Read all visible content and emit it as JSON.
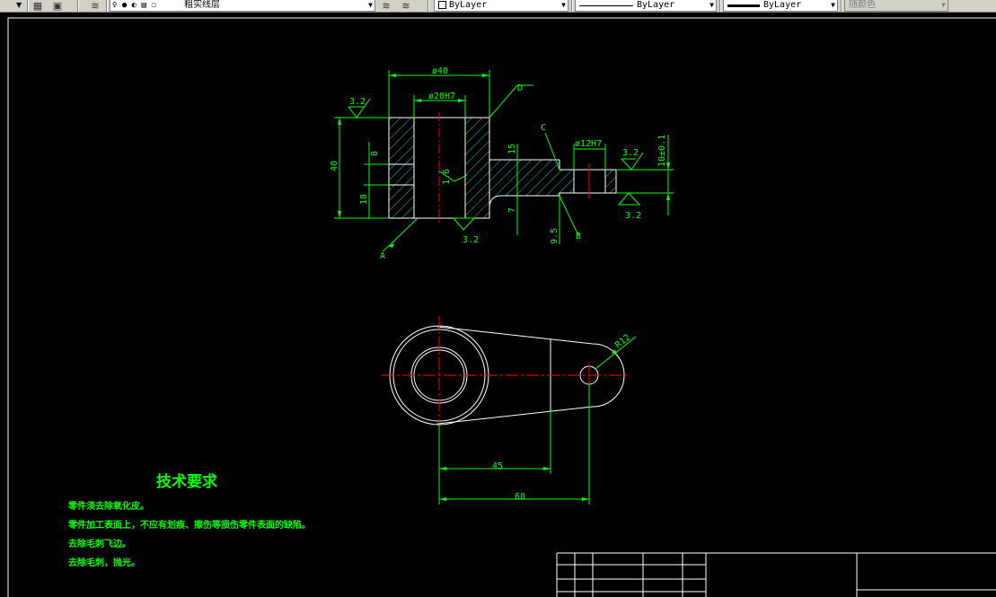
{
  "toolbar": {
    "layer_name": "粗实线层",
    "color_value": "ByLayer",
    "linetype_value": "ByLayer",
    "lineweight_value": "ByLayer",
    "plotstyle_value": "随颜色"
  },
  "drawing": {
    "section_dims": {
      "d40": "ø40",
      "d20h7": "ø20H7",
      "h40": "40",
      "h8": "8",
      "h18": "18",
      "r16": "1.6",
      "h15": "15",
      "h7": "7",
      "h9_5": "9.5",
      "d12h7": "ø12H7",
      "h10": "10±0.1",
      "r32a": "3.2",
      "r32b": "3.2",
      "r32c": "3.2",
      "r32d": "3.2"
    },
    "labels": {
      "A": "A",
      "B": "B",
      "C": "C",
      "D": "D"
    },
    "plan_dims": {
      "r12": "R12",
      "d45": "45",
      "d60": "60"
    }
  },
  "tech_requirements": {
    "title": "技术要求",
    "items": [
      "零件须去除氧化皮。",
      "零件加工表面上，不应有划痕、擦伤等损伤零件表面的缺陷。",
      "去除毛刺飞边。",
      "去除毛刺，抛光。"
    ]
  },
  "colors": {
    "background": "#000000",
    "outline": "#ffffff",
    "dimension": "#00ff00",
    "center": "#ff0000",
    "hatch": "#00ffff"
  }
}
